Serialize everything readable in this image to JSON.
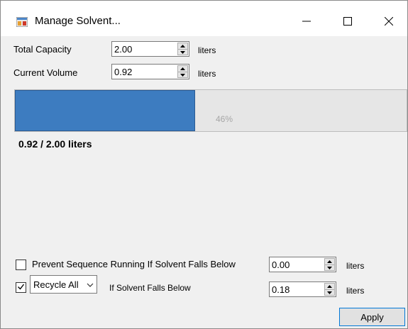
{
  "window": {
    "title": "Manage Solvent..."
  },
  "titlebar": {
    "minimize_glyph": "—",
    "close_glyph": "✕"
  },
  "capacity": {
    "label": "Total Capacity",
    "value": "2.00",
    "unit": "liters"
  },
  "volume": {
    "label": "Current Volume",
    "value": "0.92",
    "unit": "liters"
  },
  "progress": {
    "percent_text": "46%",
    "fraction": 0.46,
    "fill_color": "#3d7cc0"
  },
  "summary": {
    "text": "0.92 / 2.00 liters"
  },
  "prevent": {
    "checked": false,
    "label": "Prevent Sequence Running If Solvent Falls Below",
    "value": "0.00",
    "unit": "liters"
  },
  "recycle": {
    "checked": true,
    "selected": "Recycle All",
    "label": "If Solvent Falls Below",
    "value": "0.18",
    "unit": "liters"
  },
  "apply_label": "Apply",
  "icons": {
    "app": "app-icon",
    "minimize": "minimize-icon",
    "maximize": "maximize-icon",
    "close": "close-icon"
  }
}
